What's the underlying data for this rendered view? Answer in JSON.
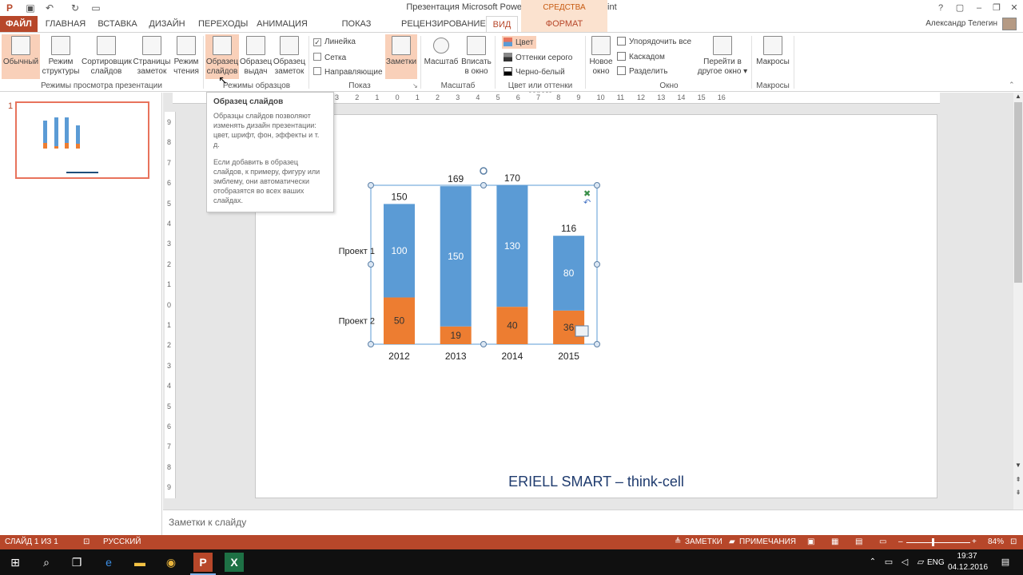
{
  "window": {
    "title": "Презентация Microsoft PowerPoint.pptx - PowerPoint",
    "context_tab_group": "СРЕДСТВА РИСОВАНИЯ",
    "user_name": "Александр Телегин",
    "help": "?"
  },
  "tabs": [
    {
      "label": "ФАЙЛ"
    },
    {
      "label": "ГЛАВНАЯ"
    },
    {
      "label": "ВСТАВКА"
    },
    {
      "label": "ДИЗАЙН"
    },
    {
      "label": "ПЕРЕХОДЫ"
    },
    {
      "label": "АНИМАЦИЯ"
    },
    {
      "label": "ПОКАЗ СЛАЙДОВ"
    },
    {
      "label": "РЕЦЕНЗИРОВАНИЕ"
    },
    {
      "label": "ВИД"
    },
    {
      "label": "ФОРМАТ"
    }
  ],
  "ribbon": {
    "views": {
      "normal": [
        "Обычный"
      ],
      "outline": [
        "Режим",
        "структуры"
      ],
      "sorter": [
        "Сортировщик",
        "слайдов"
      ],
      "notes_page": [
        "Страницы",
        "заметок"
      ],
      "reading": [
        "Режим",
        "чтения"
      ],
      "group_label": "Режимы просмотра презентации"
    },
    "masters": {
      "slide_master": [
        "Образец",
        "слайдов"
      ],
      "handout_master": [
        "Образец",
        "выдач"
      ],
      "notes_master": [
        "Образец",
        "заметок"
      ],
      "group_label": "Режимы образцов"
    },
    "show": {
      "ruler": "Линейка",
      "gridlines": "Сетка",
      "guides": "Направляющие",
      "notes": "Заметки",
      "group_label": "Показ"
    },
    "zoom": {
      "zoom": "Масштаб",
      "fit": [
        "Вписать",
        "в окно"
      ],
      "group_label": "Масштаб"
    },
    "color": {
      "color": "Цвет",
      "grayscale": "Оттенки серого",
      "bw": "Черно-белый",
      "group_label": "Цвет или оттенки серого"
    },
    "window": {
      "new_window": [
        "Новое",
        "окно"
      ],
      "arrange_all": "Упорядочить все",
      "cascade": "Каскадом",
      "split": "Разделить",
      "switch": [
        "Перейти в",
        "другое окно"
      ],
      "group_label": "Окно"
    },
    "macros": {
      "macros": "Макросы",
      "group_label": "Макросы"
    }
  },
  "thumbnail": {
    "number": "1"
  },
  "tooltip": {
    "title": "Образец слайдов",
    "p1": "Образцы слайдов позволяют изменять дизайн презентации: цвет, шрифт, фон, эффекты и т. д.",
    "p2": "Если добавить в образец слайдов, к примеру, фигуру или эмблему, они автоматически отобразятся во всех ваших слайдах."
  },
  "slide": {
    "footer_text": "ERIELL SMART – think-cell"
  },
  "chart_data": {
    "type": "bar",
    "stacked": true,
    "categories": [
      "2012",
      "2013",
      "2014",
      "2015"
    ],
    "series": [
      {
        "name": "Проект 2",
        "values": [
          50,
          19,
          40,
          36
        ],
        "color": "#ed7d31"
      },
      {
        "name": "Проект 1",
        "values": [
          100,
          150,
          130,
          80
        ],
        "color": "#5b9bd5"
      }
    ],
    "totals": [
      150,
      169,
      170,
      116
    ],
    "legend_position": "left"
  },
  "notes": {
    "placeholder": "Заметки к слайду"
  },
  "status": {
    "slide_info": "СЛАЙД 1 ИЗ 1",
    "language": "РУССКИЙ",
    "notes": "ЗАМЕТКИ",
    "comments": "ПРИМЕЧАНИЯ",
    "zoom": "84%"
  },
  "taskbar": {
    "time": "19:37",
    "date": "04.12.2016",
    "lang": "ENG"
  },
  "ruler": {
    "h_ticks": [
      "3",
      "2",
      "1",
      "0",
      "1",
      "2",
      "3",
      "4",
      "5",
      "6",
      "7",
      "8",
      "9",
      "10",
      "11",
      "12",
      "13",
      "14",
      "15",
      "16"
    ],
    "v_ticks": [
      "9",
      "8",
      "7",
      "6",
      "5",
      "4",
      "3",
      "2",
      "1",
      "0",
      "1",
      "2",
      "3",
      "4",
      "5",
      "6",
      "7",
      "8",
      "9"
    ]
  }
}
